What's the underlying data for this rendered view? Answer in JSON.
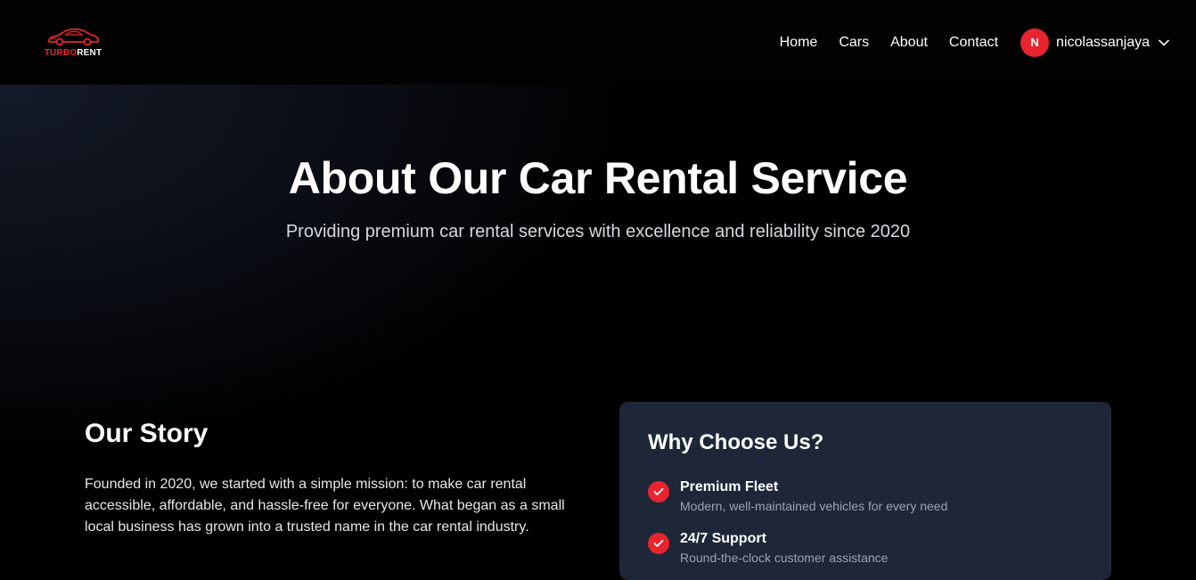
{
  "brand": {
    "part1": "TURBO",
    "part2": "RENT",
    "accent": "#e8242f"
  },
  "nav": {
    "links": [
      "Home",
      "Cars",
      "About",
      "Contact"
    ],
    "user": {
      "initial": "N",
      "name": "nicolassanjaya",
      "menu_icon": "chevron-down-icon"
    }
  },
  "hero": {
    "title": "About Our Car Rental Service",
    "subtitle": "Providing premium car rental services with excellence and reliability since 2020"
  },
  "story": {
    "heading": "Our Story",
    "body": "Founded in 2020, we started with a simple mission: to make car rental accessible, affordable, and hassle-free for everyone. What began as a small local business has grown into a trusted name in the car rental industry."
  },
  "why": {
    "heading": "Why Choose Us?",
    "features": [
      {
        "title": "Premium Fleet",
        "desc": "Modern, well-maintained vehicles for every need",
        "icon": "check-icon"
      },
      {
        "title": "24/7 Support",
        "desc": "Round-the-clock customer assistance",
        "icon": "check-icon"
      }
    ]
  }
}
